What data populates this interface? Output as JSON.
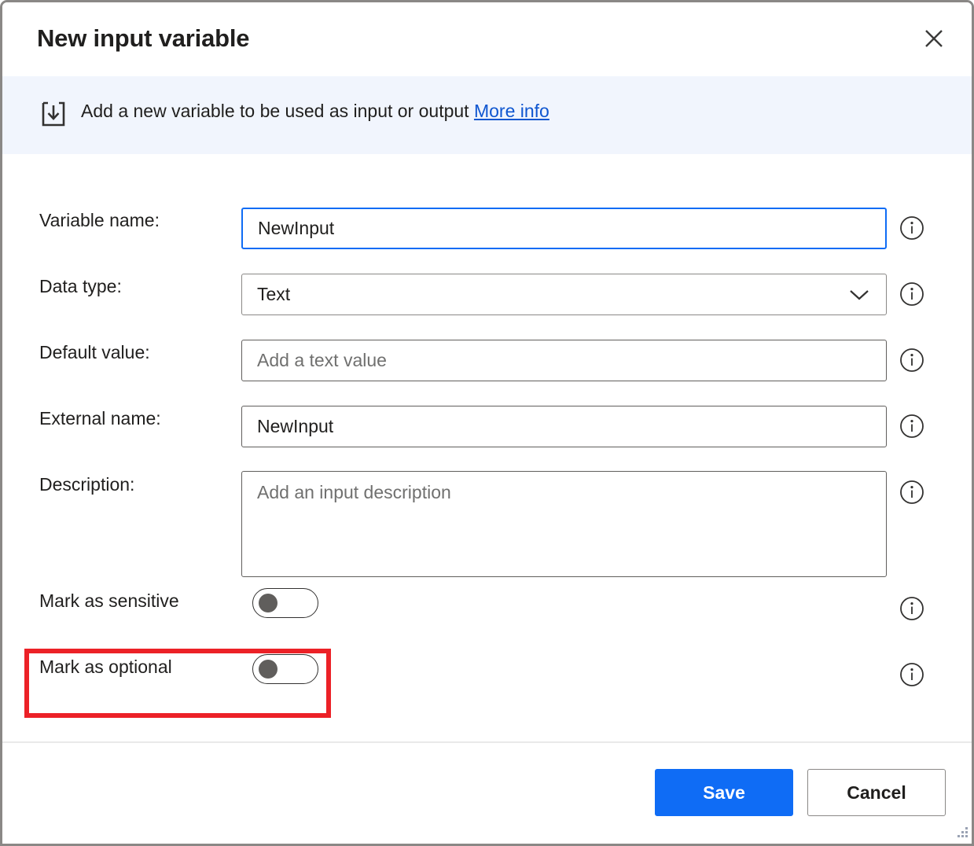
{
  "window": {
    "title": "New input variable",
    "close_icon": "close-icon",
    "resize_grip": "resize-grip-icon"
  },
  "banner": {
    "icon": "input-download-icon",
    "text": "Add a new variable to be used as input or output",
    "link_label": "More info",
    "background_color": "#f1f5fd",
    "link_color": "#0f56d0"
  },
  "form": {
    "fields": [
      {
        "label": "Variable name:",
        "value": "NewInput",
        "placeholder": "",
        "kind": "text",
        "focused": true,
        "info_icon": "info-icon"
      },
      {
        "label": "Data type:",
        "value": "Text",
        "placeholder": "",
        "kind": "select",
        "focused": false,
        "info_icon": "info-icon",
        "chevron_icon": "chevron-down-icon"
      },
      {
        "label": "Default value:",
        "value": "",
        "placeholder": "Add a text value",
        "kind": "text",
        "focused": false,
        "info_icon": "info-icon"
      },
      {
        "label": "External name:",
        "value": "NewInput",
        "placeholder": "",
        "kind": "text",
        "focused": false,
        "info_icon": "info-icon"
      },
      {
        "label": "Description:",
        "value": "",
        "placeholder": "Add an input description",
        "kind": "textarea",
        "focused": false,
        "info_icon": "info-icon"
      }
    ],
    "toggles": [
      {
        "label": "Mark as sensitive",
        "state": "off",
        "info_icon": "info-icon",
        "highlighted": false
      },
      {
        "label": "Mark as optional",
        "state": "off",
        "info_icon": "info-icon",
        "highlighted": true
      }
    ]
  },
  "annotation": {
    "color": "#ec2127",
    "target": "Mark as optional"
  },
  "footer": {
    "save_label": "Save",
    "cancel_label": "Cancel",
    "save_color": "#0f6cf5"
  }
}
